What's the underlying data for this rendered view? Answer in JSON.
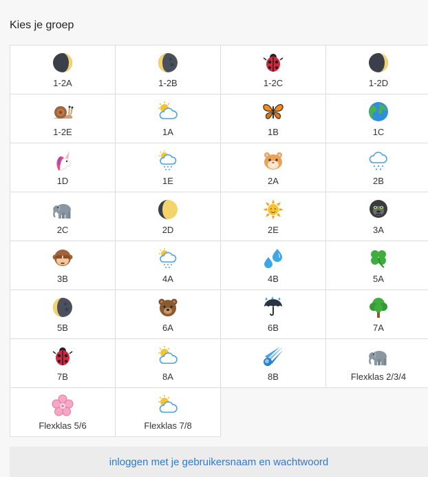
{
  "heading": "Kies je groep",
  "groups": [
    {
      "label": "1-2A",
      "icon": "moon-icon"
    },
    {
      "label": "1-2B",
      "icon": "dark-moon-icon"
    },
    {
      "label": "1-2C",
      "icon": "ladybug-icon"
    },
    {
      "label": "1-2D",
      "icon": "moon-icon"
    },
    {
      "label": "1-2E",
      "icon": "snail-icon"
    },
    {
      "label": "1A",
      "icon": "sun-cloud-icon"
    },
    {
      "label": "1B",
      "icon": "butterfly-icon"
    },
    {
      "label": "1C",
      "icon": "globe-icon"
    },
    {
      "label": "1D",
      "icon": "unicorn-icon"
    },
    {
      "label": "1E",
      "icon": "sun-rain-cloud-icon"
    },
    {
      "label": "2A",
      "icon": "hamster-icon"
    },
    {
      "label": "2B",
      "icon": "rain-cloud-icon"
    },
    {
      "label": "2C",
      "icon": "elephant-icon"
    },
    {
      "label": "2D",
      "icon": "crescent-moon-icon"
    },
    {
      "label": "2E",
      "icon": "sun-icon"
    },
    {
      "label": "3A",
      "icon": "gorilla-icon"
    },
    {
      "label": "3B",
      "icon": "see-no-evil-monkey-icon"
    },
    {
      "label": "4A",
      "icon": "sun-rain-cloud-icon"
    },
    {
      "label": "4B",
      "icon": "droplets-icon"
    },
    {
      "label": "5A",
      "icon": "clover-icon"
    },
    {
      "label": "5B",
      "icon": "dark-moon-icon"
    },
    {
      "label": "6A",
      "icon": "bear-icon"
    },
    {
      "label": "6B",
      "icon": "umbrella-rain-icon"
    },
    {
      "label": "7A",
      "icon": "tree-icon"
    },
    {
      "label": "7B",
      "icon": "ladybug-icon"
    },
    {
      "label": "8A",
      "icon": "sun-cloud-icon"
    },
    {
      "label": "8B",
      "icon": "comet-icon"
    },
    {
      "label": "Flexklas 2/3/4",
      "icon": "elephant-icon"
    },
    {
      "label": "Flexklas 5/6",
      "icon": "cherry-blossom-icon"
    },
    {
      "label": "Flexklas 7/8",
      "icon": "sun-cloud-icon"
    }
  ],
  "login_link": "inloggen met je gebruikersnaam en wachtwoord",
  "colors": {
    "link": "#2a7ad6",
    "background": "#f7f7f7",
    "tile_border": "#dcdcdc"
  }
}
